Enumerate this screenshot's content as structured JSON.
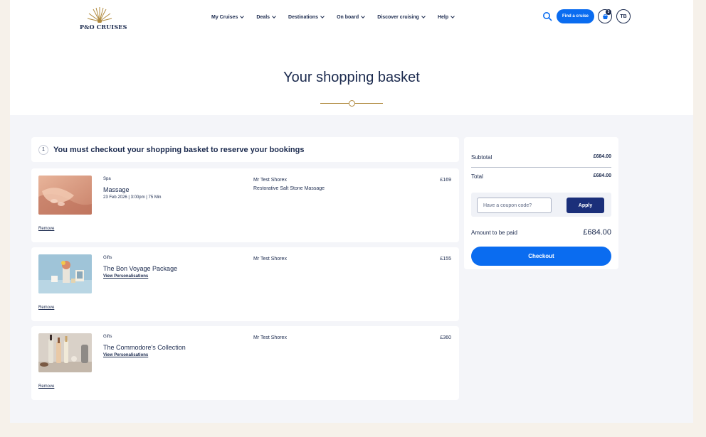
{
  "brand": {
    "logo_text": "P&O CRUISES"
  },
  "nav": {
    "items": [
      {
        "label": "My Cruises"
      },
      {
        "label": "Deals"
      },
      {
        "label": "Destinations"
      },
      {
        "label": "On board"
      },
      {
        "label": "Discover cruising"
      },
      {
        "label": "Help"
      }
    ]
  },
  "header_actions": {
    "find_cruise_label": "Find a cruise",
    "basket_count": "3",
    "avatar_initials": "TB"
  },
  "page": {
    "title": "Your shopping basket"
  },
  "notice": {
    "step": "1",
    "text": "You must checkout your shopping basket to reserve your bookings"
  },
  "items": [
    {
      "category": "Spa",
      "name": "Massage",
      "detail": "23 Feb 2026 | 3:00pm | 75 Min",
      "guest": "Mr Test Shorex",
      "sub": "Restorative Salt Stone Massage",
      "price": "£169",
      "remove_label": "Remove"
    },
    {
      "category": "Gifts",
      "name": "The Bon Voyage Package",
      "link": "View Personalisations",
      "guest": "Mr Test Shorex",
      "price": "£155",
      "remove_label": "Remove"
    },
    {
      "category": "Gifts",
      "name": "The Commodore's Collection",
      "link": "View Personalisations",
      "guest": "Mr Test Shorex",
      "price": "£360",
      "remove_label": "Remove"
    }
  ],
  "summary": {
    "subtotal_label": "Subtotal",
    "subtotal_value": "£684.00",
    "total_label": "Total",
    "total_value": "£684.00",
    "coupon_placeholder": "Have a coupon code?",
    "apply_label": "Apply",
    "amount_label": "Amount to be paid",
    "amount_value": "£684.00",
    "checkout_label": "Checkout"
  },
  "colors": {
    "primary_blue": "#0a6cf0",
    "navy": "#1b2a4e",
    "apply_navy": "#1b2f7a",
    "gold": "#b08a3e",
    "page_bg": "#f6f1ea"
  }
}
